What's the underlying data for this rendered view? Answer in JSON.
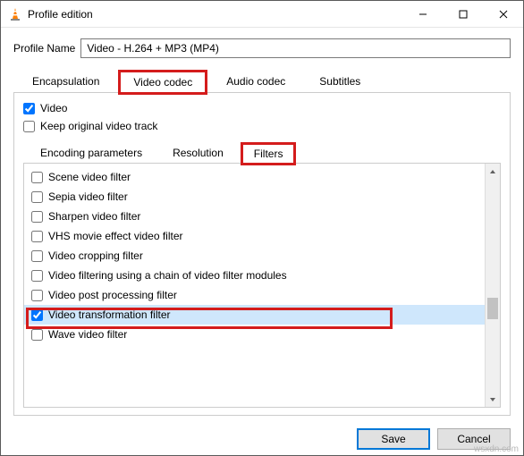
{
  "window": {
    "title": "Profile edition",
    "minimize": "–",
    "maximize": "☐",
    "close": "✕"
  },
  "profile": {
    "label": "Profile Name",
    "value": "Video - H.264 + MP3 (MP4)"
  },
  "tabs": {
    "encapsulation": "Encapsulation",
    "video_codec": "Video codec",
    "audio_codec": "Audio codec",
    "subtitles": "Subtitles"
  },
  "video_panel": {
    "video_chk": "Video",
    "keep_original": "Keep original video track",
    "subtabs": {
      "encoding": "Encoding parameters",
      "resolution": "Resolution",
      "filters": "Filters"
    },
    "filters": [
      {
        "label": "Scene video filter",
        "checked": false,
        "selected": false
      },
      {
        "label": "Sepia video filter",
        "checked": false,
        "selected": false
      },
      {
        "label": "Sharpen video filter",
        "checked": false,
        "selected": false
      },
      {
        "label": "VHS movie effect video filter",
        "checked": false,
        "selected": false
      },
      {
        "label": "Video cropping filter",
        "checked": false,
        "selected": false
      },
      {
        "label": "Video filtering using a chain of video filter modules",
        "checked": false,
        "selected": false
      },
      {
        "label": "Video post processing filter",
        "checked": false,
        "selected": false
      },
      {
        "label": "Video transformation filter",
        "checked": true,
        "selected": true
      },
      {
        "label": "Wave video filter",
        "checked": false,
        "selected": false
      }
    ]
  },
  "buttons": {
    "save": "Save",
    "cancel": "Cancel"
  },
  "watermark": "wsxdn.com"
}
